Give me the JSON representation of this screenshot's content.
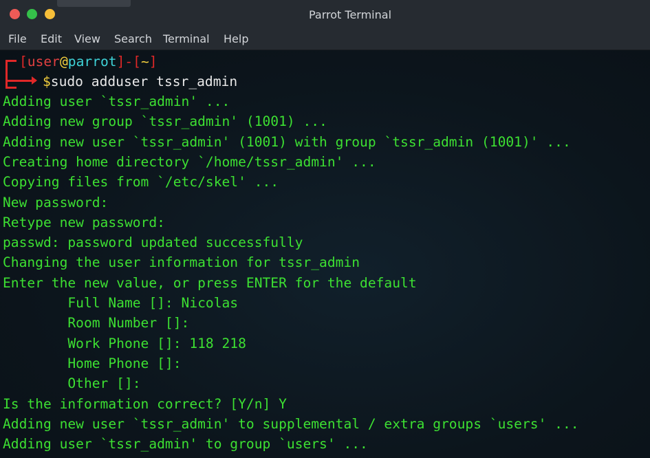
{
  "window": {
    "title": "Parrot Terminal"
  },
  "menu": {
    "items": [
      "File",
      "Edit",
      "View",
      "Search",
      "Terminal",
      "Help"
    ]
  },
  "prompt": {
    "open_bracket": "[",
    "user": "user",
    "at": "@",
    "host": "parrot",
    "close_bracket": "]",
    "dash": "-",
    "path_open": "[",
    "path": "~",
    "path_close": "]",
    "dollar": "$",
    "command": "sudo adduser tssr_admin"
  },
  "output": [
    "Adding user `tssr_admin' ...",
    "Adding new group `tssr_admin' (1001) ...",
    "Adding new user `tssr_admin' (1001) with group `tssr_admin (1001)' ...",
    "Creating home directory `/home/tssr_admin' ...",
    "Copying files from `/etc/skel' ...",
    "New password:",
    "Retype new password:",
    "passwd: password updated successfully",
    "Changing the user information for tssr_admin",
    "Enter the new value, or press ENTER for the default",
    "        Full Name []: Nicolas",
    "        Room Number []:",
    "        Work Phone []: 118 218",
    "        Home Phone []:",
    "        Other []:",
    "Is the information correct? [Y/n] Y",
    "Adding new user `tssr_admin' to supplemental / extra groups `users' ...",
    "Adding user `tssr_admin' to group `users' ..."
  ],
  "colors": {
    "output_green": "#3de032",
    "prompt_red": "#e02828",
    "prompt_yellow": "#f3cf3d",
    "prompt_cyan": "#3fd3d8"
  }
}
